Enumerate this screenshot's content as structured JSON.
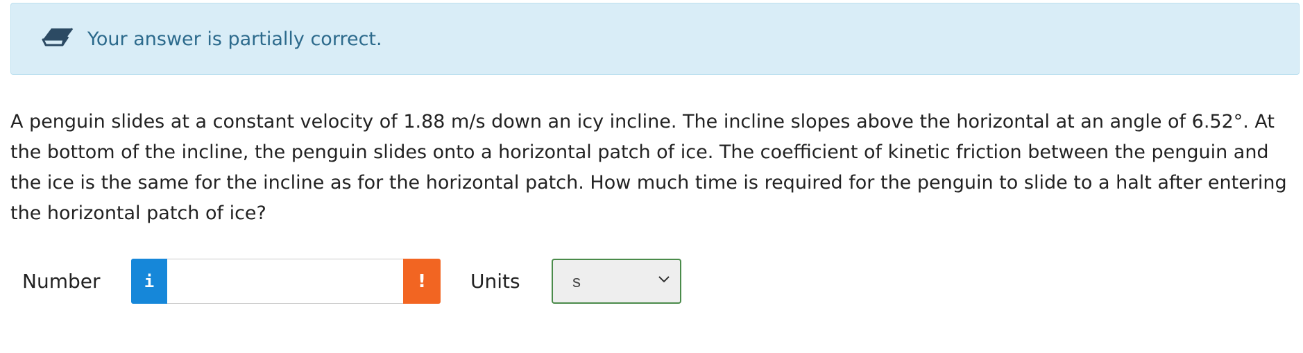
{
  "feedback": {
    "icon": "eraser-icon",
    "message": "Your answer is partially correct.",
    "background_color": "#d9edf7",
    "text_color": "#2c6a8c"
  },
  "question": {
    "text": "A penguin slides at a constant velocity of 1.88 m/s down an icy incline. The incline slopes above the horizontal at an angle of 6.52°. At the bottom of the incline, the penguin slides onto a horizontal patch of ice. The coefficient of kinetic friction between the penguin and the ice is the same for the incline as for the horizontal patch. How much time is required for the penguin to slide to a halt after entering the horizontal patch of ice?"
  },
  "answer": {
    "number_label": "Number",
    "info_icon": "info-icon",
    "info_glyph": "i",
    "info_color": "#1687d9",
    "number_value": "",
    "warning_icon": "exclamation-icon",
    "warning_glyph": "!",
    "warning_color": "#f26522",
    "units_label": "Units",
    "units_selected": "s",
    "units_border_color": "#4a8b4a"
  }
}
